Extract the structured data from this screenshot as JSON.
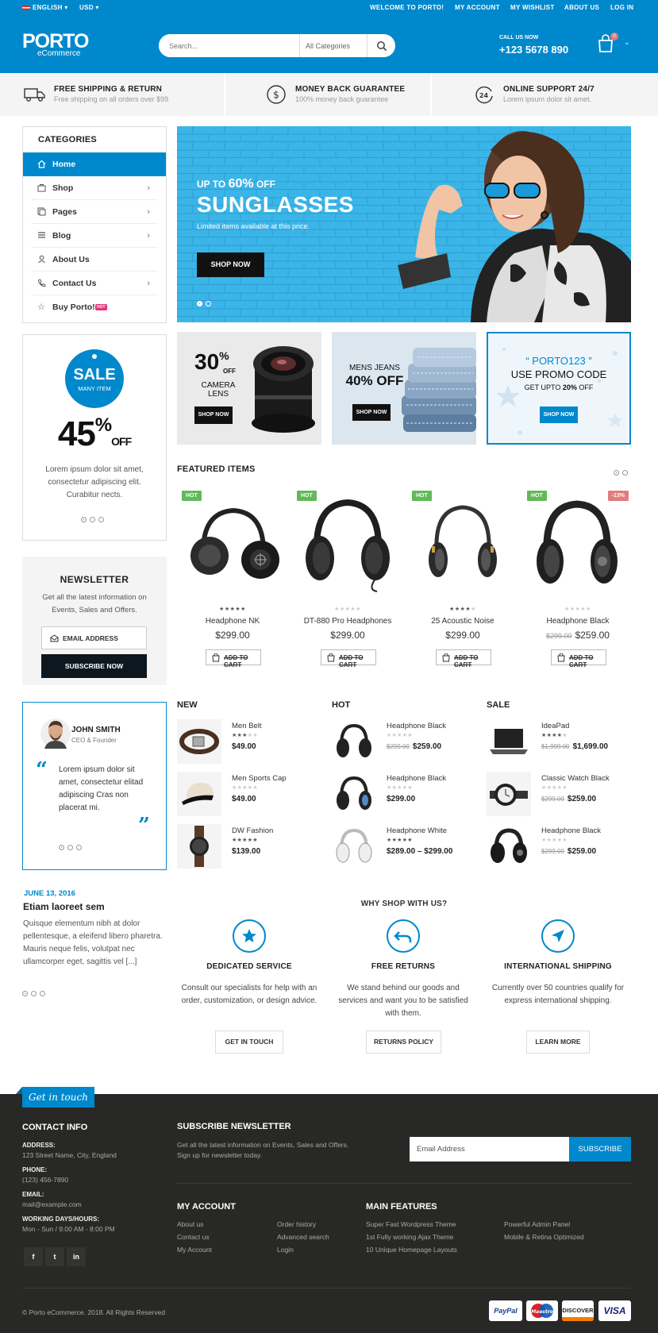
{
  "topbar": {
    "language": "ENGLISH",
    "currency": "USD",
    "welcome": "WELCOME TO PORTO!",
    "my_account": "MY ACCOUNT",
    "my_wishlist": "MY WISHLIST",
    "about_us": "ABOUT US",
    "log_in": "LOG IN"
  },
  "header": {
    "logo": "PORTO",
    "logo_sub": "eCommerce",
    "search_placeholder": "Search...",
    "search_category": "All Categories",
    "call_label": "CALL US NOW",
    "phone": "+123 5678 890",
    "cart_count": "0"
  },
  "infobar": [
    {
      "title": "FREE SHIPPING & RETURN",
      "sub": "Free shipping on all orders over $99",
      "icon": "truck-icon"
    },
    {
      "title": "MONEY BACK GUARANTEE",
      "sub": "100% money back guarantee",
      "icon": "dollar-icon"
    },
    {
      "title": "ONLINE SUPPORT 24/7",
      "sub": "Lorem ipsum dolor sit amet.",
      "icon": "support-24-icon"
    }
  ],
  "categories": {
    "title": "CATEGORIES",
    "items": [
      {
        "label": "Home",
        "icon": "home-icon"
      },
      {
        "label": "Shop",
        "icon": "shop-icon"
      },
      {
        "label": "Pages",
        "icon": "pages-icon"
      },
      {
        "label": "Blog",
        "icon": "blog-icon"
      },
      {
        "label": "About Us",
        "icon": "about-icon"
      },
      {
        "label": "Contact Us",
        "icon": "phone-icon"
      },
      {
        "label": "Buy Porto!",
        "icon": "star-icon",
        "badge": "HOT"
      }
    ]
  },
  "hero": {
    "up_prefix": "UP TO ",
    "up_pct": "60%",
    "up_suffix": " OFF",
    "title": "SUNGLASSES",
    "subtitle": "Limited items available at this price.",
    "button": "SHOP NOW"
  },
  "sale": {
    "big": "SALE",
    "many": "MANY ITEM",
    "pct": "45",
    "pct_sign": "%",
    "off": "OFF",
    "text": "Lorem ipsum dolor sit amet, consectetur adipiscing elit. Curabitur nects."
  },
  "banners": {
    "camera": {
      "pct": "30",
      "pct_sign": "%",
      "off": "OFF",
      "l1": "CAMERA",
      "l2": "LENS",
      "button": "SHOP NOW"
    },
    "jeans": {
      "l1": "MENS JEANS",
      "l2": "40% OFF",
      "button": "SHOP NOW"
    },
    "promo": {
      "code": "“ PORTO123 ”",
      "l1": "USE PROMO CODE",
      "l2_prefix": "GET UPTO ",
      "l2_bold": "20%",
      "l2_suffix": " OFF",
      "button": "SHOP NOW"
    }
  },
  "newsletter": {
    "title": "NEWSLETTER",
    "text": "Get all the latest information on Events, Sales and Offers.",
    "placeholder": "EMAIL ADDRESS",
    "button": "SUBSCRIBE NOW"
  },
  "featured": {
    "title": "FEATURED ITEMS",
    "add_to_cart": "ADD TO CART",
    "products": [
      {
        "badge": "HOT",
        "name": "Headphone NK",
        "price": "$299.00",
        "old": "",
        "rating": 5
      },
      {
        "badge": "HOT",
        "name": "DT-880 Pro Headphones",
        "price": "$299.00",
        "old": "",
        "rating": 0
      },
      {
        "badge": "HOT",
        "name": "25 Acoustic Noise",
        "price": "$299.00",
        "old": "",
        "rating": 4
      },
      {
        "badge": "HOT",
        "badge2": "-13%",
        "name": "Headphone Black",
        "price": "$259.00",
        "old": "$299.00",
        "rating": 0
      }
    ]
  },
  "testimonial": {
    "name": "JOHN SMITH",
    "role": "CEO & Founder",
    "quote": "Lorem ipsum dolor sit amet, consectetur elitad adipiscing Cras non placerat mi."
  },
  "lists": {
    "new": {
      "title": "NEW",
      "items": [
        {
          "name": "Men Belt",
          "price": "$49.00",
          "old": "",
          "rating": 3
        },
        {
          "name": "Men Sports Cap",
          "price": "$49.00",
          "old": "",
          "rating": 0
        },
        {
          "name": "DW Fashion",
          "price": "$139.00",
          "old": "",
          "rating": 5
        }
      ]
    },
    "hot": {
      "title": "HOT",
      "items": [
        {
          "name": "Headphone Black",
          "price": "$259.00",
          "old": "$299.00",
          "rating": 0
        },
        {
          "name": "Headphone Black",
          "price": "$299.00",
          "old": "",
          "rating": 0
        },
        {
          "name": "Headphone White",
          "price": "$289.00 – $299.00",
          "old": "",
          "rating": 5
        }
      ]
    },
    "sale": {
      "title": "SALE",
      "items": [
        {
          "name": "IdeaPad",
          "price": "$1,699.00",
          "old": "$1,999.00",
          "rating": 4
        },
        {
          "name": "Classic Watch Black",
          "price": "$259.00",
          "old": "$299.00",
          "rating": 0
        },
        {
          "name": "Headphone Black",
          "price": "$259.00",
          "old": "$299.00",
          "rating": 0
        }
      ]
    }
  },
  "blog": {
    "date": "JUNE 13, 2016",
    "title": "Etiam laoreet sem",
    "text": "Quisque elementum nibh at dolor pellentesque, a eleifend libero pharetra. Mauris neque felis, volutpat nec ullamcorper eget, sagittis vel [...]"
  },
  "why": {
    "title": "WHY SHOP WITH US?",
    "items": [
      {
        "title": "DEDICATED SERVICE",
        "text": "Consult our specialists for help with an order, customization, or design advice.",
        "button": "GET IN TOUCH",
        "icon": "star-icon"
      },
      {
        "title": "FREE RETURNS",
        "text": "We stand behind our goods and services and want you to be satisfied with them.",
        "button": "RETURNS POLICY",
        "icon": "return-icon"
      },
      {
        "title": "INTERNATIONAL SHIPPING",
        "text": "Currently over 50 countries qualify for express international shipping.",
        "button": "LEARN MORE",
        "icon": "send-icon"
      }
    ]
  },
  "footer": {
    "get_in_touch": "Get in touch",
    "contact_title": "CONTACT INFO",
    "address_label": "ADDRESS:",
    "address": "123 Street Name, City, England",
    "phone_label": "PHONE:",
    "phone": "(123) 456-7890",
    "email_label": "EMAIL:",
    "email": "mail@example.com",
    "hours_label": "WORKING DAYS/HOURS:",
    "hours": "Mon - Sun / 9:00 AM - 8:00 PM",
    "subscribe_title": "SUBSCRIBE NEWSLETTER",
    "subscribe_text1": "Get all the latest information on Events, Sales and Offers.",
    "subscribe_text2": "Sign up for newsletter today.",
    "email_placeholder": "Email Address",
    "subscribe_button": "SUBSCRIBE",
    "account_title": "MY ACCOUNT",
    "account_links": [
      "About us",
      "Contact us",
      "My Account",
      "Order history",
      "Advanced search",
      "Login"
    ],
    "features_title": "MAIN FEATURES",
    "features_links": [
      "Super Fast Wordpress Theme",
      "1st Fully working Ajax Theme",
      "10 Unique Homepage Layouts",
      "Powerful Admin Panel",
      "Mobile & Retina Optimized"
    ],
    "copyright": "© Porto eCommerce. 2018. All Rights Reserved",
    "payments": [
      "PayPal",
      "Maestro",
      "DISCOVER",
      "VISA"
    ]
  },
  "colors": {
    "brand": "#0088cc",
    "dark": "#282826",
    "hot": "#62b959",
    "sale": "#e27c7c"
  }
}
